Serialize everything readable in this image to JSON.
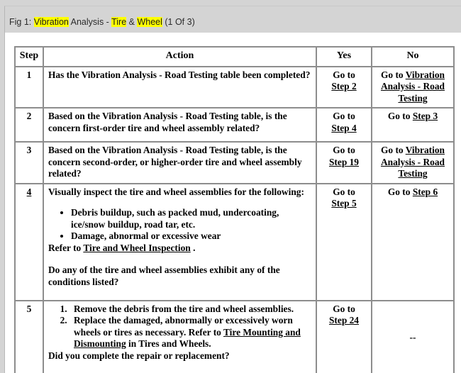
{
  "figure": {
    "prefix": "Fig 1: ",
    "segments": [
      {
        "text": "Vibration",
        "highlight": true
      },
      {
        "text": " Analysis - ",
        "highlight": false
      },
      {
        "text": "Tire",
        "highlight": true
      },
      {
        "text": " & ",
        "highlight": false
      },
      {
        "text": "Wheel",
        "highlight": true
      },
      {
        "text": " (1 Of 3)",
        "highlight": false
      }
    ],
    "full_text": "Fig 1: Vibration Analysis - Tire & Wheel (1 Of 3)",
    "highlight_color": "#ffff00"
  },
  "table": {
    "headers": {
      "step": "Step",
      "action": "Action",
      "yes": "Yes",
      "no": "No"
    },
    "rows": [
      {
        "step": "1",
        "step_underlined": false,
        "action_text": "Has the Vibration Analysis - Road Testing table been completed?",
        "yes_prefix": "Go to ",
        "yes_link": "Step 2",
        "no_prefix": "Go to ",
        "no_link": "Vibration Analysis - Road Testing"
      },
      {
        "step": "2",
        "step_underlined": false,
        "action_text": "Based on the Vibration Analysis - Road Testing table, is the concern first-order tire and wheel assembly related?",
        "yes_prefix": "Go to ",
        "yes_link": "Step 4",
        "no_prefix": "Go to ",
        "no_link": "Step 3"
      },
      {
        "step": "3",
        "step_underlined": false,
        "action_text": "Based on the Vibration Analysis - Road Testing table, is the concern second-order, or higher-order tire and wheel assembly related?",
        "yes_prefix": "Go to ",
        "yes_link": "Step 19",
        "no_prefix": "Go to ",
        "no_link": "Vibration Analysis - Road Testing"
      },
      {
        "step": "4",
        "step_underlined": true,
        "action_intro": "Visually inspect the tire and wheel assemblies for the following:",
        "action_bullets": [
          "Debris buildup, such as packed mud, undercoating, ice/snow buildup, road tar, etc.",
          "Damage, abnormal or excessive wear"
        ],
        "action_refer_prefix": "Refer to ",
        "action_refer_link": "Tire and Wheel Inspection",
        "action_refer_suffix": " .",
        "action_question": "Do any of the tire and wheel assemblies exhibit any of the conditions listed?",
        "yes_prefix": "Go to ",
        "yes_link": "Step 5",
        "no_prefix": "Go to ",
        "no_link": "Step 6"
      },
      {
        "step": "5",
        "step_underlined": false,
        "action_ordered": [
          {
            "text_before": "Remove the debris from the tire and wheel assemblies.",
            "link": "",
            "text_after": ""
          },
          {
            "text_before": "Replace the damaged, abnormally or excessively worn wheels or tires as necessary. Refer to ",
            "link": "Tire Mounting and Dismounting",
            "text_after": " in Tires and Wheels."
          }
        ],
        "action_question": "Did you complete the repair or replacement?",
        "yes_prefix": "Go to ",
        "yes_link": "Step 24",
        "no_text": "--"
      }
    ]
  },
  "colors": {
    "band": "#d4d4d4",
    "border": "#8d8d8d",
    "text": "#000000",
    "highlight": "#ffff00"
  }
}
